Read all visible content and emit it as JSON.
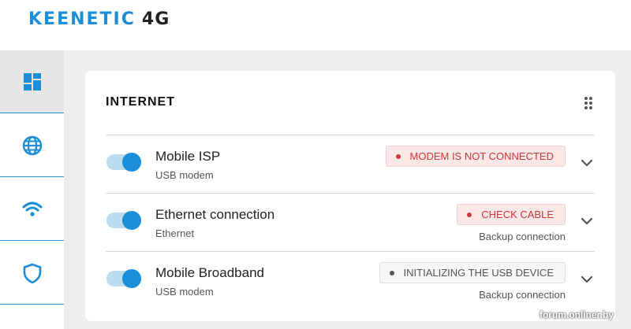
{
  "header": {
    "brand": "KEENETIC",
    "model": "4G"
  },
  "sidebar": {
    "items": [
      {
        "icon": "dashboard-icon",
        "active": true
      },
      {
        "icon": "globe-icon",
        "active": false
      },
      {
        "icon": "wifi-icon",
        "active": false
      },
      {
        "icon": "shield-icon",
        "active": false
      }
    ]
  },
  "card": {
    "title": "INTERNET",
    "connections": [
      {
        "name": "Mobile ISP",
        "type": "USB modem",
        "enabled": true,
        "status": "MODEM IS NOT CONNECTED",
        "status_kind": "error",
        "note": ""
      },
      {
        "name": "Ethernet connection",
        "type": "Ethernet",
        "enabled": true,
        "status": "CHECK CABLE",
        "status_kind": "error",
        "note": "Backup connection"
      },
      {
        "name": "Mobile Broadband",
        "type": "USB modem",
        "enabled": true,
        "status": "INITIALIZING THE USB DEVICE",
        "status_kind": "neutral",
        "note": "Backup connection"
      }
    ]
  },
  "watermark": "forum.onliner.by",
  "colors": {
    "accent": "#1a8ed8",
    "error": "#d0363b",
    "background": "#eeeeee"
  }
}
